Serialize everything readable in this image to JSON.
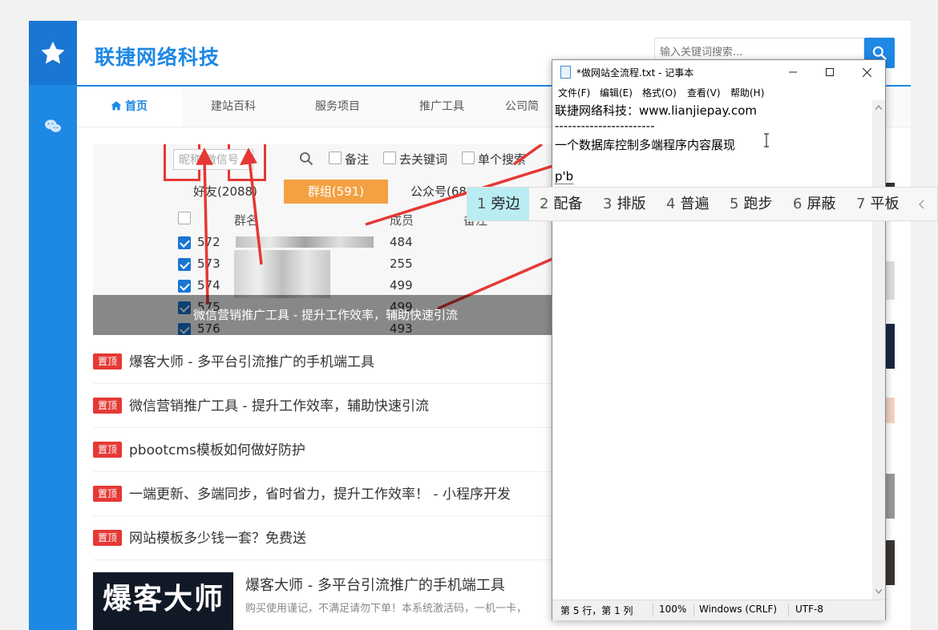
{
  "site": {
    "logo": "联捷网络科技",
    "search_placeholder": "输入关键词搜索...",
    "nav": [
      {
        "label": "首页",
        "icon": "home-icon",
        "active": true
      },
      {
        "label": "建站百科"
      },
      {
        "label": "服务项目"
      },
      {
        "label": "推广工具"
      },
      {
        "label": "公司简"
      }
    ],
    "banner": {
      "caption": "微信营销推广工具 - 提升工作效率，辅助快速引流",
      "search_ph": "昵称/微信号",
      "checks": [
        "备注",
        "去关键词",
        "单个搜索"
      ],
      "tabs": [
        "好友(2088)",
        "群组(591)",
        "公众号(68"
      ],
      "table_headers": [
        "群名",
        "成员",
        "备注"
      ],
      "rows": [
        {
          "id": "572",
          "members": "484"
        },
        {
          "id": "573",
          "members": "255"
        },
        {
          "id": "574",
          "members": "499"
        },
        {
          "id": "575",
          "members": "499"
        },
        {
          "id": "576",
          "members": "493"
        }
      ]
    },
    "pin_label": "置顶",
    "topics": [
      "爆客大师 - 多平台引流推广的手机端工具",
      "微信营销推广工具 - 提升工作效率，辅助快速引流",
      "pbootcms模板如何做好防护",
      "一端更新、多端同步，省时省力，提升工作效率！ - 小程序开发",
      "网站模板多少钱一套？免费送"
    ],
    "article": {
      "thumb_text": "爆客大师",
      "title": "爆客大师 - 多平台引流推广的手机端工具",
      "desc": "购买使用谨记，不满足请勿下单！本系统激活码，一机一卡，"
    }
  },
  "notepad": {
    "title": "*做网站全流程.txt - 记事本",
    "menu": [
      "文件(F)",
      "编辑(E)",
      "格式(O)",
      "查看(V)",
      "帮助(H)"
    ],
    "lines": [
      "联捷网络科技：www.lianjiepay.com",
      "-----------------------",
      "一个数据库控制多端程序内容展现",
      "",
      "p'b"
    ],
    "status": {
      "position": "第 5 行，第 1 列",
      "zoom": "100%",
      "eol": "Windows (CRLF)",
      "encoding": "UTF-8"
    }
  },
  "ime": {
    "candidates": [
      {
        "num": "1",
        "word": "旁边"
      },
      {
        "num": "2",
        "word": "配备"
      },
      {
        "num": "3",
        "word": "排版"
      },
      {
        "num": "4",
        "word": "普遍"
      },
      {
        "num": "5",
        "word": "跑步"
      },
      {
        "num": "6",
        "word": "屏蔽"
      },
      {
        "num": "7",
        "word": "平板"
      }
    ],
    "selected_index": 0
  },
  "colors": {
    "brand": "#1e88e5",
    "pin": "#e53935",
    "ime_selected": "#b9ecf3"
  }
}
